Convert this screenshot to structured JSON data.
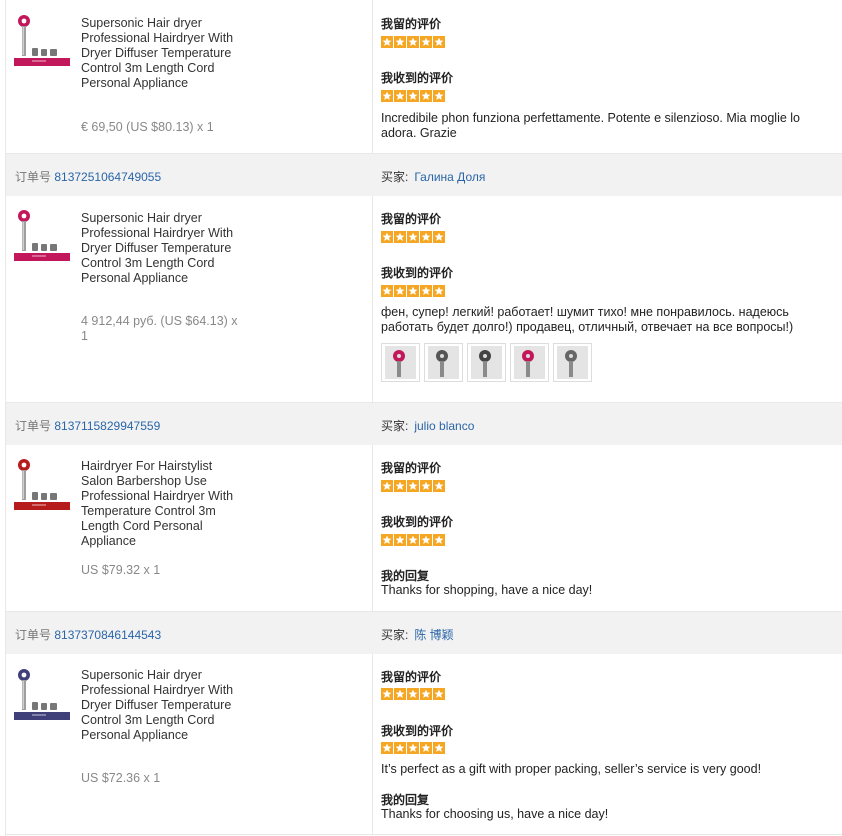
{
  "labels": {
    "order_prefix": "订单号",
    "buyer_label": "买家:",
    "my_review": "我留的评价",
    "received_review": "我收到的评价",
    "my_reply": "我的回复"
  },
  "colors": {
    "star": "#f5a623",
    "link": "#2a65a8",
    "header_bg": "#f2f2f2"
  },
  "orders": [
    {
      "product_title": "Supersonic Hair dryer Professional Hairdryer With Dryer Diffuser Temperature Control 3m Length Cord Personal Appliance",
      "price": "€ 69,50 (US $80.13) x 1",
      "my_rating": 5,
      "received_rating": 5,
      "received_text": "Incredibile phon funziona perfettamente. Potente e silenzioso. Mia moglie lo adora. Grazie",
      "product_color": "#c2185b"
    },
    {
      "order_number": "8137251064749055",
      "buyer_name": "Галина Доля",
      "product_title": "Supersonic Hair dryer Professional Hairdryer With Dryer Diffuser Temperature Control 3m Length Cord Personal Appliance",
      "price": "4 912,44 руб. (US $64.13) x 1",
      "my_rating": 5,
      "received_rating": 5,
      "received_text": "фен, супер! легкий! работает! шумит тихо! мне понравилось. надеюсь работать будет долго!) продавец, отличный, отвечает на все вопросы!)",
      "photos": [
        "photo-1",
        "photo-2",
        "photo-3",
        "photo-4",
        "photo-5"
      ],
      "product_color": "#c2185b"
    },
    {
      "order_number": "8137115829947559",
      "buyer_name": "julio blanco",
      "product_title": "Hairdryer For Hairstylist Salon Barbershop Use Professional Hairdryer With Temperature Control 3m Length Cord Personal Appliance",
      "price": "US $79.32 x 1",
      "my_rating": 5,
      "received_rating": 5,
      "reply_text": "Thanks for shopping, have a nice day!",
      "product_color": "#b71c1c"
    },
    {
      "order_number": "8137370846144543",
      "buyer_name": "陈 博颖",
      "product_title": "Supersonic Hair dryer Professional Hairdryer With Dryer Diffuser Temperature Control 3m Length Cord Personal Appliance",
      "price": "US $72.36 x 1",
      "my_rating": 5,
      "received_rating": 5,
      "received_text": "It’s perfect as a gift with proper packing, seller’s service is very good!",
      "reply_text": "Thanks for choosing us, have a nice day!",
      "product_color": "#3f3f7a"
    }
  ]
}
